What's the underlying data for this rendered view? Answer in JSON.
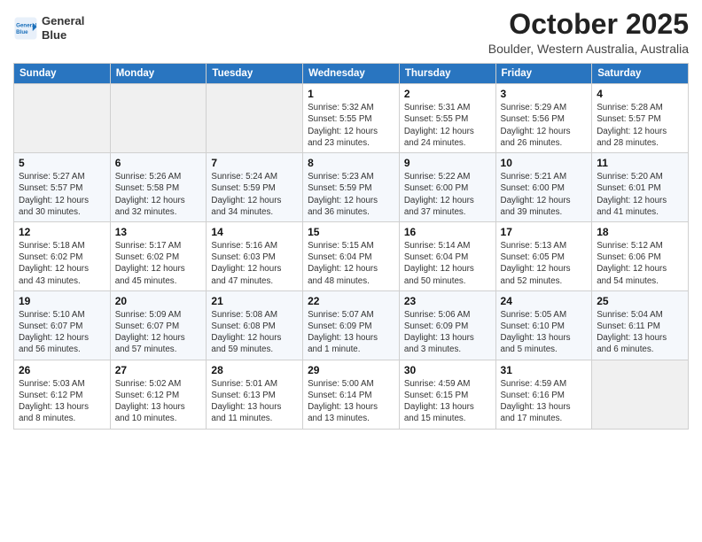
{
  "header": {
    "logo_line1": "General",
    "logo_line2": "Blue",
    "month_title": "October 2025",
    "location": "Boulder, Western Australia, Australia"
  },
  "weekdays": [
    "Sunday",
    "Monday",
    "Tuesday",
    "Wednesday",
    "Thursday",
    "Friday",
    "Saturday"
  ],
  "weeks": [
    [
      {
        "day": "",
        "sunrise": "",
        "sunset": "",
        "daylight": ""
      },
      {
        "day": "",
        "sunrise": "",
        "sunset": "",
        "daylight": ""
      },
      {
        "day": "",
        "sunrise": "",
        "sunset": "",
        "daylight": ""
      },
      {
        "day": "1",
        "sunrise": "Sunrise: 5:32 AM",
        "sunset": "Sunset: 5:55 PM",
        "daylight": "Daylight: 12 hours and 23 minutes."
      },
      {
        "day": "2",
        "sunrise": "Sunrise: 5:31 AM",
        "sunset": "Sunset: 5:55 PM",
        "daylight": "Daylight: 12 hours and 24 minutes."
      },
      {
        "day": "3",
        "sunrise": "Sunrise: 5:29 AM",
        "sunset": "Sunset: 5:56 PM",
        "daylight": "Daylight: 12 hours and 26 minutes."
      },
      {
        "day": "4",
        "sunrise": "Sunrise: 5:28 AM",
        "sunset": "Sunset: 5:57 PM",
        "daylight": "Daylight: 12 hours and 28 minutes."
      }
    ],
    [
      {
        "day": "5",
        "sunrise": "Sunrise: 5:27 AM",
        "sunset": "Sunset: 5:57 PM",
        "daylight": "Daylight: 12 hours and 30 minutes."
      },
      {
        "day": "6",
        "sunrise": "Sunrise: 5:26 AM",
        "sunset": "Sunset: 5:58 PM",
        "daylight": "Daylight: 12 hours and 32 minutes."
      },
      {
        "day": "7",
        "sunrise": "Sunrise: 5:24 AM",
        "sunset": "Sunset: 5:59 PM",
        "daylight": "Daylight: 12 hours and 34 minutes."
      },
      {
        "day": "8",
        "sunrise": "Sunrise: 5:23 AM",
        "sunset": "Sunset: 5:59 PM",
        "daylight": "Daylight: 12 hours and 36 minutes."
      },
      {
        "day": "9",
        "sunrise": "Sunrise: 5:22 AM",
        "sunset": "Sunset: 6:00 PM",
        "daylight": "Daylight: 12 hours and 37 minutes."
      },
      {
        "day": "10",
        "sunrise": "Sunrise: 5:21 AM",
        "sunset": "Sunset: 6:00 PM",
        "daylight": "Daylight: 12 hours and 39 minutes."
      },
      {
        "day": "11",
        "sunrise": "Sunrise: 5:20 AM",
        "sunset": "Sunset: 6:01 PM",
        "daylight": "Daylight: 12 hours and 41 minutes."
      }
    ],
    [
      {
        "day": "12",
        "sunrise": "Sunrise: 5:18 AM",
        "sunset": "Sunset: 6:02 PM",
        "daylight": "Daylight: 12 hours and 43 minutes."
      },
      {
        "day": "13",
        "sunrise": "Sunrise: 5:17 AM",
        "sunset": "Sunset: 6:02 PM",
        "daylight": "Daylight: 12 hours and 45 minutes."
      },
      {
        "day": "14",
        "sunrise": "Sunrise: 5:16 AM",
        "sunset": "Sunset: 6:03 PM",
        "daylight": "Daylight: 12 hours and 47 minutes."
      },
      {
        "day": "15",
        "sunrise": "Sunrise: 5:15 AM",
        "sunset": "Sunset: 6:04 PM",
        "daylight": "Daylight: 12 hours and 48 minutes."
      },
      {
        "day": "16",
        "sunrise": "Sunrise: 5:14 AM",
        "sunset": "Sunset: 6:04 PM",
        "daylight": "Daylight: 12 hours and 50 minutes."
      },
      {
        "day": "17",
        "sunrise": "Sunrise: 5:13 AM",
        "sunset": "Sunset: 6:05 PM",
        "daylight": "Daylight: 12 hours and 52 minutes."
      },
      {
        "day": "18",
        "sunrise": "Sunrise: 5:12 AM",
        "sunset": "Sunset: 6:06 PM",
        "daylight": "Daylight: 12 hours and 54 minutes."
      }
    ],
    [
      {
        "day": "19",
        "sunrise": "Sunrise: 5:10 AM",
        "sunset": "Sunset: 6:07 PM",
        "daylight": "Daylight: 12 hours and 56 minutes."
      },
      {
        "day": "20",
        "sunrise": "Sunrise: 5:09 AM",
        "sunset": "Sunset: 6:07 PM",
        "daylight": "Daylight: 12 hours and 57 minutes."
      },
      {
        "day": "21",
        "sunrise": "Sunrise: 5:08 AM",
        "sunset": "Sunset: 6:08 PM",
        "daylight": "Daylight: 12 hours and 59 minutes."
      },
      {
        "day": "22",
        "sunrise": "Sunrise: 5:07 AM",
        "sunset": "Sunset: 6:09 PM",
        "daylight": "Daylight: 13 hours and 1 minute."
      },
      {
        "day": "23",
        "sunrise": "Sunrise: 5:06 AM",
        "sunset": "Sunset: 6:09 PM",
        "daylight": "Daylight: 13 hours and 3 minutes."
      },
      {
        "day": "24",
        "sunrise": "Sunrise: 5:05 AM",
        "sunset": "Sunset: 6:10 PM",
        "daylight": "Daylight: 13 hours and 5 minutes."
      },
      {
        "day": "25",
        "sunrise": "Sunrise: 5:04 AM",
        "sunset": "Sunset: 6:11 PM",
        "daylight": "Daylight: 13 hours and 6 minutes."
      }
    ],
    [
      {
        "day": "26",
        "sunrise": "Sunrise: 5:03 AM",
        "sunset": "Sunset: 6:12 PM",
        "daylight": "Daylight: 13 hours and 8 minutes."
      },
      {
        "day": "27",
        "sunrise": "Sunrise: 5:02 AM",
        "sunset": "Sunset: 6:12 PM",
        "daylight": "Daylight: 13 hours and 10 minutes."
      },
      {
        "day": "28",
        "sunrise": "Sunrise: 5:01 AM",
        "sunset": "Sunset: 6:13 PM",
        "daylight": "Daylight: 13 hours and 11 minutes."
      },
      {
        "day": "29",
        "sunrise": "Sunrise: 5:00 AM",
        "sunset": "Sunset: 6:14 PM",
        "daylight": "Daylight: 13 hours and 13 minutes."
      },
      {
        "day": "30",
        "sunrise": "Sunrise: 4:59 AM",
        "sunset": "Sunset: 6:15 PM",
        "daylight": "Daylight: 13 hours and 15 minutes."
      },
      {
        "day": "31",
        "sunrise": "Sunrise: 4:59 AM",
        "sunset": "Sunset: 6:16 PM",
        "daylight": "Daylight: 13 hours and 17 minutes."
      },
      {
        "day": "",
        "sunrise": "",
        "sunset": "",
        "daylight": ""
      }
    ]
  ]
}
